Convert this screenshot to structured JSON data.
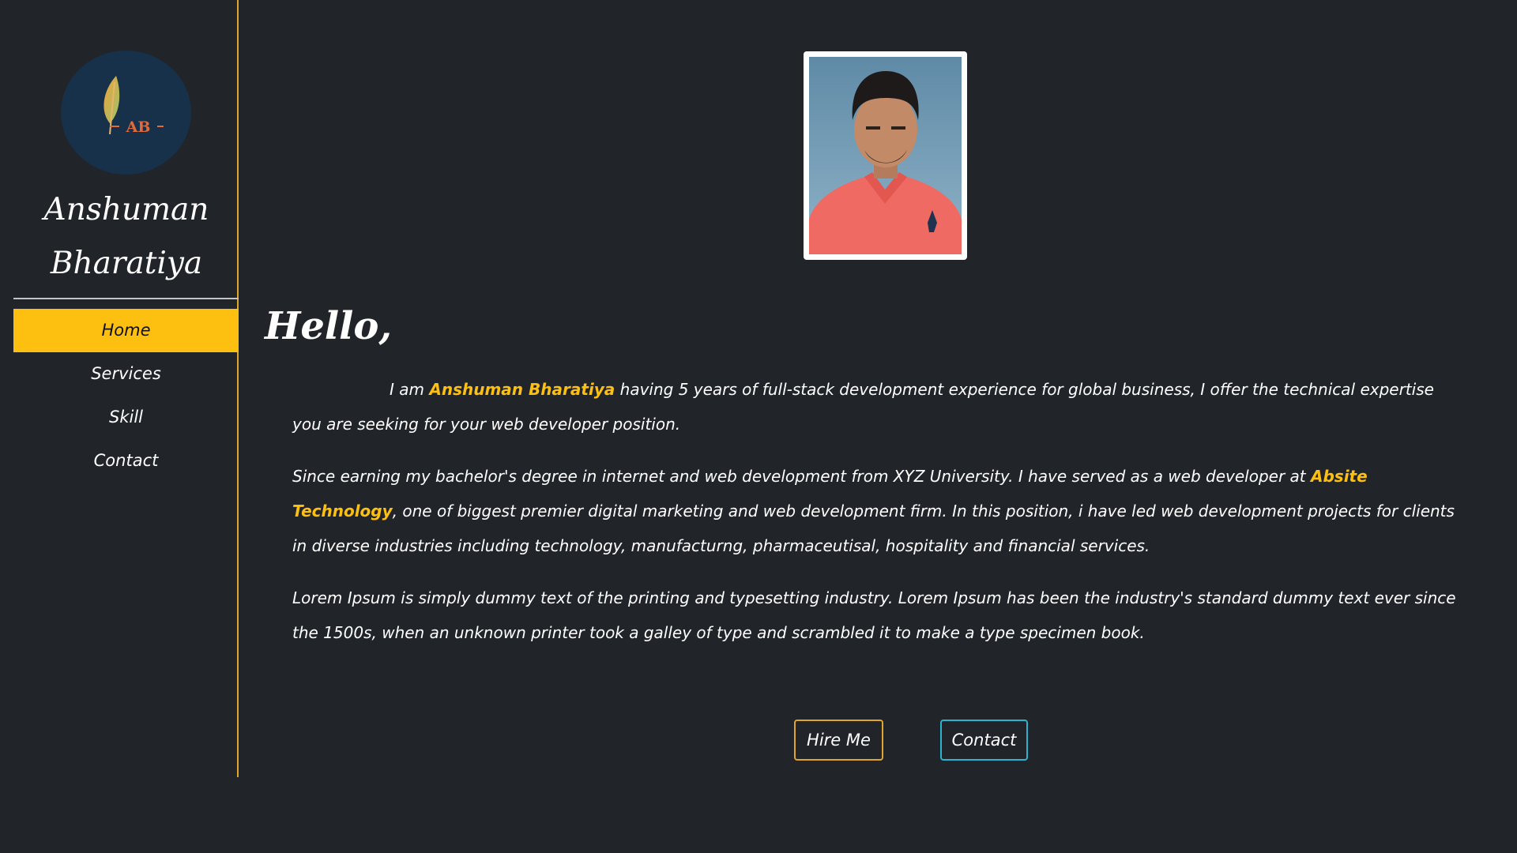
{
  "sidebar": {
    "logo_text": "AB",
    "name_line1": "Anshuman",
    "name_line2": "Bharatiya",
    "nav": [
      {
        "label": "Home",
        "active": true
      },
      {
        "label": "Services",
        "active": false
      },
      {
        "label": "Skill",
        "active": false
      },
      {
        "label": "Contact",
        "active": false
      }
    ]
  },
  "main": {
    "greeting": "Hello,",
    "intro": {
      "before": "I am ",
      "name": "Anshuman Bharatiya",
      "after": " having 5 years of full-stack development experience for global business, I offer the technical expertise you are seeking for your web developer position."
    },
    "education": {
      "before": "Since earning my bachelor's degree in internet and web development from XYZ University. I have served as a web developer at ",
      "company": "Absite Technology",
      "after": ", one of biggest premier digital marketing and web development firm. In this position, i have led web development projects for clients in diverse industries including technology, manufacturng, pharmaceutisal, hospitality and financial services."
    },
    "lorem": "Lorem Ipsum is simply dummy text of the printing and typesetting industry. Lorem Ipsum has been the industry's standard dummy text ever since the 1500s, when an unknown printer took a galley of type and scrambled it to make a type specimen book.",
    "buttons": {
      "hire": "Hire Me",
      "contact": "Contact"
    }
  },
  "colors": {
    "background": "#212429",
    "accent": "#fec010",
    "sidebar_border": "#e0a62b",
    "contact_border": "#2bb4d0",
    "logo_bg": "#17314a"
  }
}
